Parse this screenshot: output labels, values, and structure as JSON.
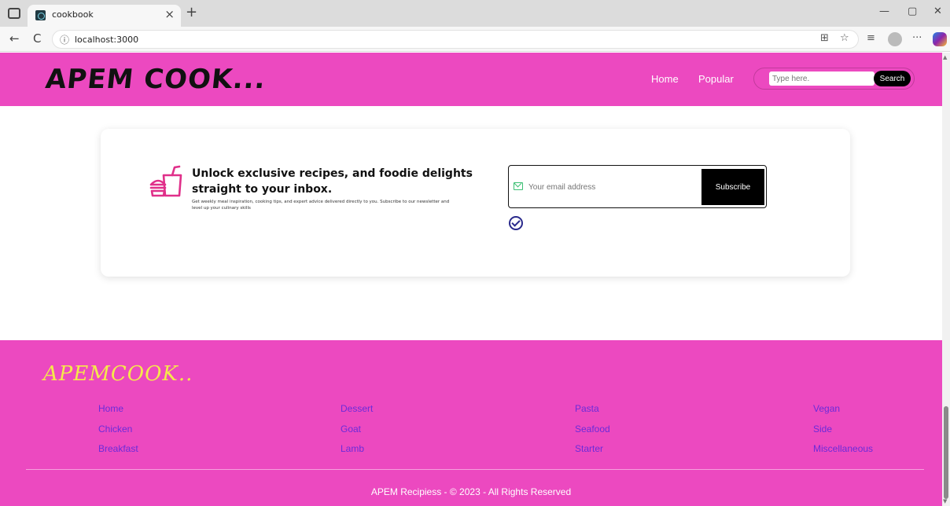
{
  "browser": {
    "tab_title": "cookbook",
    "close_glyph": "×",
    "new_tab_glyph": "+",
    "url": "localhost:3000",
    "minimize_glyph": "—",
    "restore_glyph": "▢",
    "close_window_glyph": "✕",
    "back_glyph": "←",
    "reload_glyph": "C",
    "info_glyph": "ⓘ",
    "tool_icons": [
      "split-screen-icon",
      "favorite-icon",
      "favorites-bar-icon",
      "more-icon"
    ]
  },
  "header": {
    "logo": "APEM COOK...",
    "nav": [
      "Home",
      "Popular"
    ],
    "search": {
      "placeholder": "Type here.",
      "button": "Search"
    }
  },
  "newsletter": {
    "title": "Unlock exclusive recipes, and foodie delights straight to your inbox.",
    "description": "Get weekly meal inspiration, cooking tips, and expert advice delivered directly to you. Subscribe to our newsletter and level up your culinary skills",
    "email_placeholder": "Your email address",
    "subscribe_label": "Subscribe"
  },
  "footer": {
    "logo": "APEMCOOK..",
    "columns": [
      [
        "Home",
        "Chicken",
        "Breakfast"
      ],
      [
        "Dessert",
        "Goat",
        "Lamb"
      ],
      [
        "Pasta",
        "Seafood",
        "Starter"
      ],
      [
        "Vegan",
        "Side",
        "Miscellaneous"
      ]
    ],
    "copyright": "APEM Recipiess - © 2023 - All Rights Reserved"
  },
  "colors": {
    "brand_pink": "#ec49c0",
    "footer_link": "#6c2bd9",
    "footer_logo": "#f5e94a",
    "icon_pink": "#e0308a"
  }
}
